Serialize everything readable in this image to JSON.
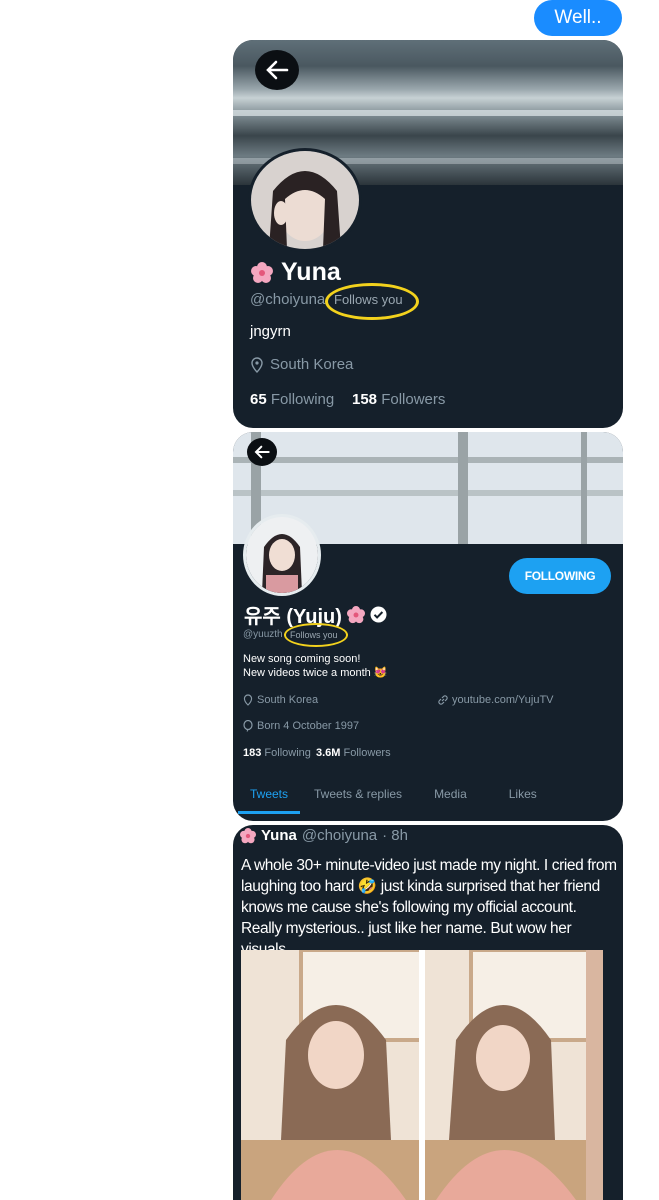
{
  "message": {
    "text": "Well.."
  },
  "profile1": {
    "name": "Yuna",
    "handle": "@choiyuna",
    "follows_you": "Follows you",
    "bio": "jngyrn",
    "location": "South Korea",
    "following_count": "65",
    "following_label": "Following",
    "followers_count": "158",
    "followers_label": "Followers"
  },
  "profile2": {
    "name": "유주 (Yuju)",
    "handle": "@yuuzth",
    "follows_you": "Follows you",
    "bio_line1": "New song coming soon!",
    "bio_line2": "New videos twice a month",
    "bio_emoji": "😻",
    "location": "South Korea",
    "website": "youtube.com/YujuTV",
    "born": "Born 4 October 1997",
    "following_count": "183",
    "following_label": "Following",
    "followers_count": "3.6M",
    "followers_label": "Followers",
    "follow_button": "FOLLOWING",
    "tabs": [
      "Tweets",
      "Tweets & replies",
      "Media",
      "Likes"
    ]
  },
  "tweet": {
    "name": "Yuna",
    "handle": "@choiyuna",
    "time": "· 8h",
    "text": "A whole 30+ minute-video just made my night. I cried from laughing too hard 🤣 just kinda surprised that her friend knows me cause she's following my official account. Really mysterious.. just like her name. But wow her visuals"
  },
  "colors": {
    "card_bg": "#15202b",
    "accent": "#1da1f2",
    "highlight_ring": "#f3d21d",
    "message_bubble": "#1a8cff"
  }
}
